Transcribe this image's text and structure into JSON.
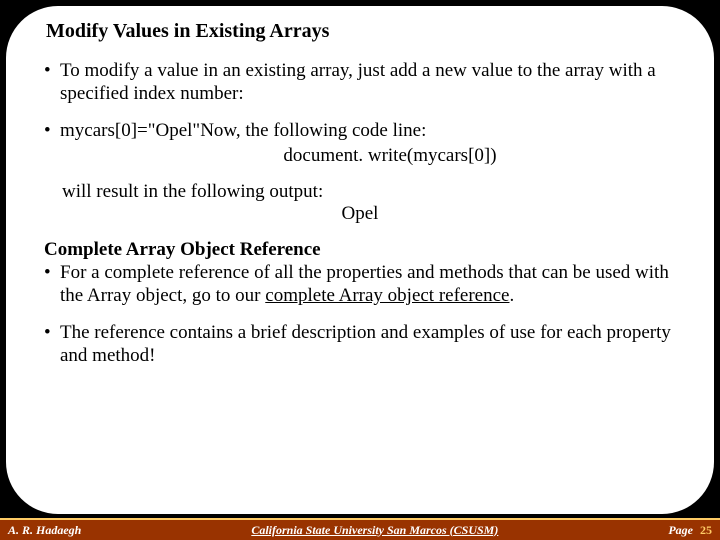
{
  "title": "Modify Values in Existing Arrays",
  "b1": "To modify a value in an existing array, just add a new value to the array with a specified index number:",
  "b2_lead": "mycars[0]=\"Opel\"",
  "b2_rest": "Now, the following code line:",
  "b2_code": "document. write(mycars[0])",
  "result_lead": "will result in the following output:",
  "result_val": "Opel",
  "subhead": "Complete Array Object Reference",
  "b3_pre": "For a complete reference of all the properties and methods that can be used with the Array object, go to our ",
  "b3_link": "complete Array object reference",
  "b3_post": ".",
  "b4": "The reference contains a brief description and examples of use for each property and method!",
  "footer": {
    "author": "A. R. Hadaegh",
    "inst": "California State University San Marcos (CSUSM)",
    "page_label": "Page",
    "page_no": "25"
  }
}
